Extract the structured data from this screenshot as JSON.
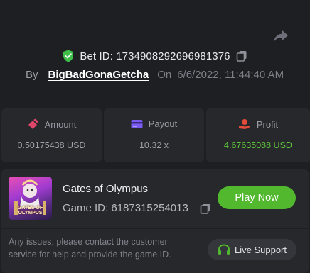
{
  "bet": {
    "id_label": "Bet ID: 1734908292696981376",
    "by_label": "By",
    "username": "BigBadGonaGetcha",
    "on_label": "On",
    "datetime": "6/6/2022, 11:44:40 AM"
  },
  "stats": {
    "amount": {
      "label": "Amount",
      "value": "0.50175438 USD",
      "icon": "coins-icon"
    },
    "payout": {
      "label": "Payout",
      "value": "10.32 x",
      "icon": "card-icon"
    },
    "profit": {
      "label": "Profit",
      "value": "4.67635088 USD",
      "icon": "hand-coin-icon"
    }
  },
  "game": {
    "thumb_title": "GATES OF OLYMPUS",
    "name": "Gates of Olympus",
    "id_label": "Game ID: 6187315254013",
    "play_label": "Play Now",
    "issue_text": "Any issues, please contact the customer service for help and provide the game ID.",
    "support_label": "Live Support"
  },
  "colors": {
    "background": "#1e1f22",
    "card": "#27282c",
    "accent_green": "#52b82e",
    "profit_green": "#5fc73a",
    "shield_green": "#3fbf4a",
    "payout_purple": "#7b5cf0",
    "amount_pink": "#e0456a",
    "profit_red": "#e24a3a"
  }
}
